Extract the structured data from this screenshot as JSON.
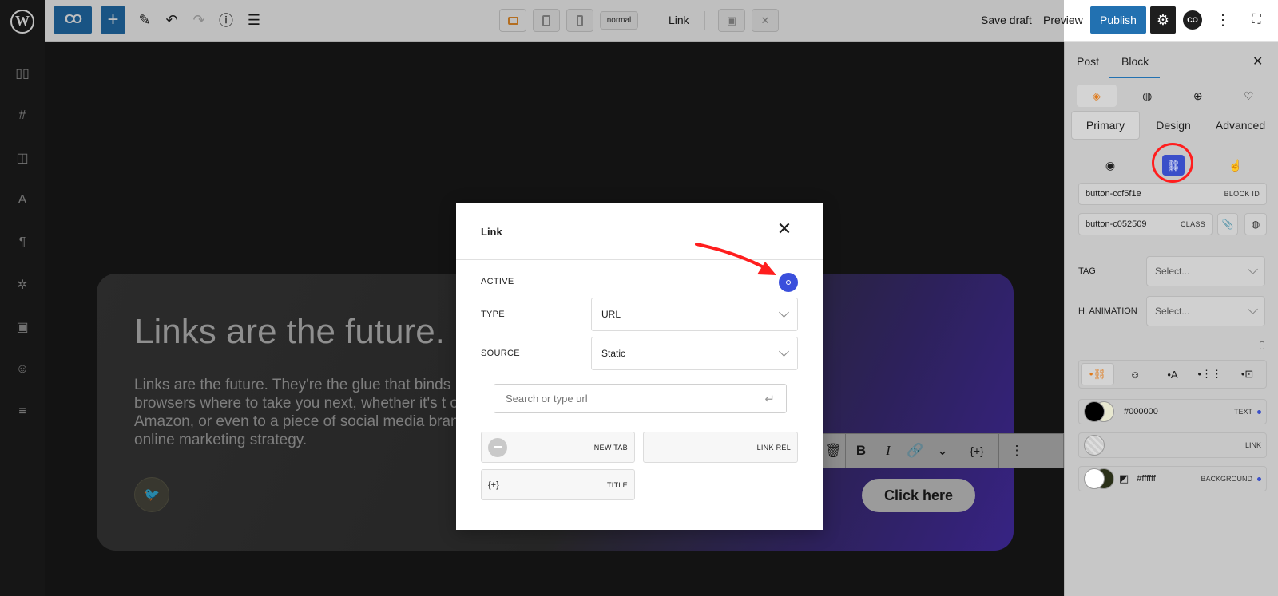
{
  "topbar": {
    "brand_label": "CO",
    "add_label": "+",
    "mode_label": "normal",
    "doc_title": "Link",
    "save_draft": "Save draft",
    "preview": "Preview",
    "publish": "Publish",
    "avatar_label": "CO"
  },
  "hero": {
    "title": "Links are the future.",
    "body": "Links are the future. They're the glue that binds browsers where to take you next, whether it's t on Amazon, or even to a piece of social media brand's online marketing strategy.",
    "cta": "Click here"
  },
  "sidebar": {
    "tab_post": "Post",
    "tab_block": "Block",
    "subtabs": [
      "Primary",
      "Design",
      "Advanced"
    ],
    "block_id_value": "button-ccf5f1e",
    "block_id_label": "BLOCK ID",
    "class_value": "button-c052509",
    "class_label": "CLASS",
    "tag_label": "TAG",
    "tag_placeholder": "Select...",
    "animation_label": "H. ANIMATION",
    "animation_placeholder": "Select...",
    "text_color_hex": "#000000",
    "text_color_label": "TEXT",
    "link_label": "LINK",
    "bg_color_hex": "#ffffff",
    "bg_label": "BACKGROUND"
  },
  "modal": {
    "title": "Link",
    "active_label": "ACTIVE",
    "type_label": "TYPE",
    "type_value": "URL",
    "source_label": "SOURCE",
    "source_value": "Static",
    "search_placeholder": "Search or type url",
    "new_tab_label": "NEW TAB",
    "link_rel_label": "LINK REL",
    "title_prefix": "{+}",
    "title_label": "TITLE"
  },
  "toolbar": {
    "dynamic_label": "{+}"
  },
  "colors": {
    "accent": "#2271b1",
    "toggle_active": "#3a4fdc",
    "annotation": "#ff1e1e"
  }
}
